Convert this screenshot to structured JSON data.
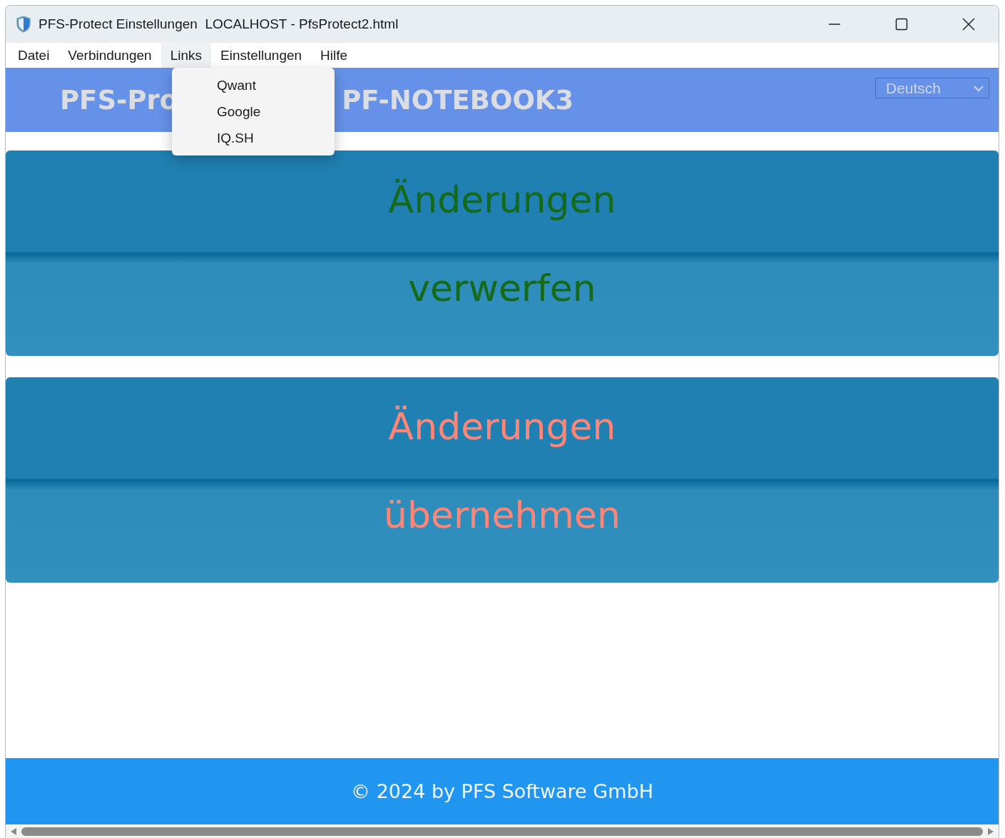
{
  "window": {
    "title": "PFS-Protect Einstellungen  LOCALHOST - PfsProtect2.html"
  },
  "menu": [
    {
      "label": "Datei",
      "selected": false
    },
    {
      "label": "Verbindungen",
      "selected": false
    },
    {
      "label": "Links",
      "selected": true
    },
    {
      "label": "Einstellungen",
      "selected": false
    },
    {
      "label": "Hilfe",
      "selected": false
    }
  ],
  "dropdown": {
    "items": [
      "Qwant",
      "Google",
      "IQ.SH"
    ]
  },
  "header": {
    "title_left": "PFS-Pro",
    "title_right": "PF-NOTEBOOK3",
    "language": "Deutsch"
  },
  "actions": [
    {
      "lines": [
        "Änderungen",
        "verwerfen"
      ],
      "kind": "discard"
    },
    {
      "lines": [
        "Änderungen",
        "übernehmen"
      ],
      "kind": "apply"
    }
  ],
  "footer": "© 2024 by PFS Software GmbH"
}
